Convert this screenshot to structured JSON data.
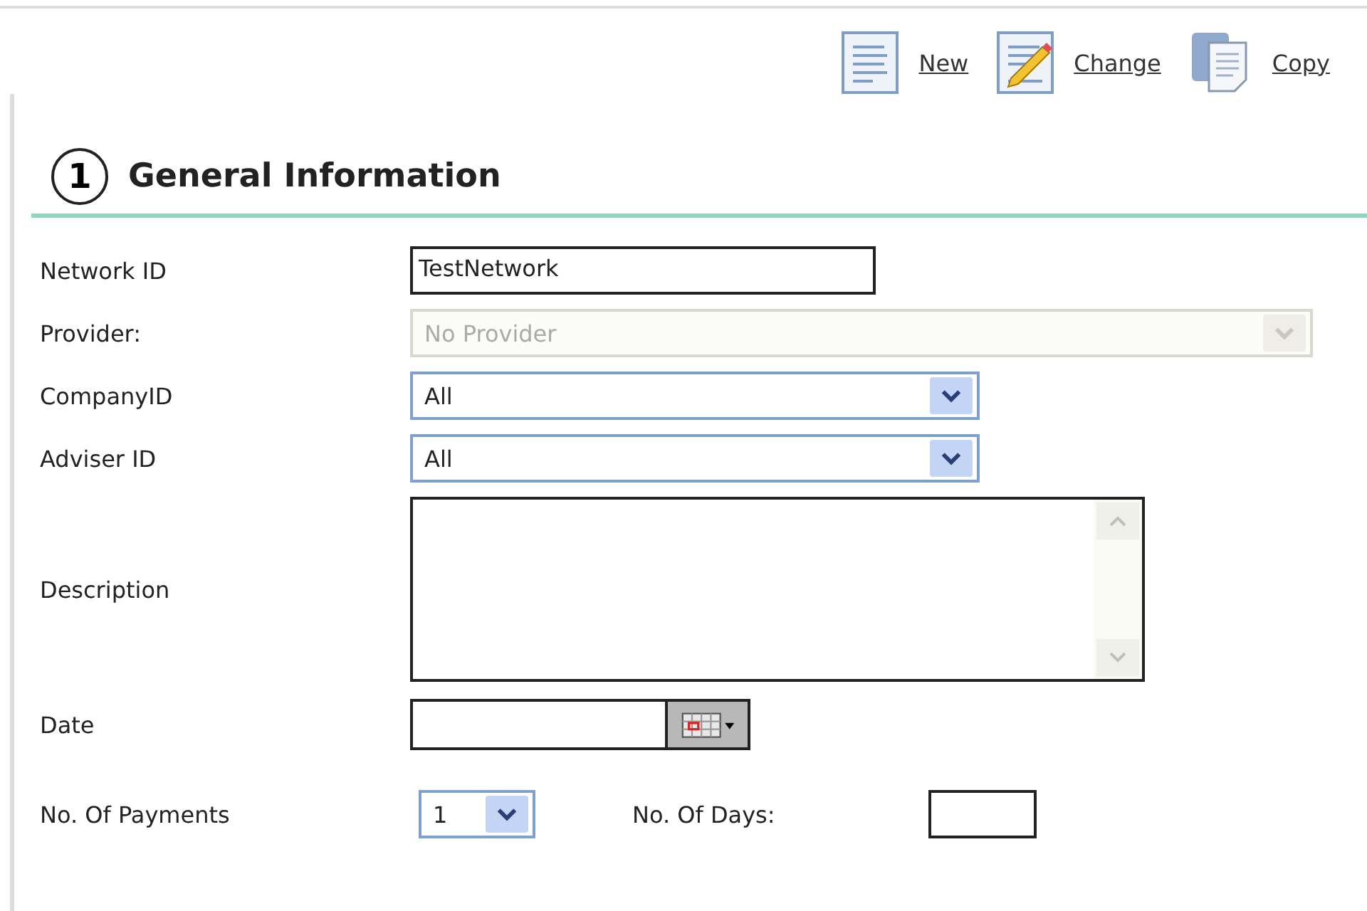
{
  "toolbar": [
    {
      "kind": "new",
      "label": "New"
    },
    {
      "kind": "change",
      "label": "Change"
    },
    {
      "kind": "copy",
      "label": "Copy"
    }
  ],
  "section": {
    "number": "1",
    "title": "General Information"
  },
  "fields": [
    {
      "kind": "text",
      "label": "Network ID",
      "value": "TestNetwork"
    },
    {
      "kind": "wide-select",
      "label": "Provider:",
      "value": "No Provider",
      "disabled": true
    },
    {
      "kind": "select",
      "label": "CompanyID",
      "value": "All",
      "disabled": false
    },
    {
      "kind": "select",
      "label": "Adviser ID",
      "value": "All",
      "disabled": false
    },
    {
      "kind": "textarea",
      "label": "Description"
    },
    {
      "kind": "date",
      "label": "Date"
    }
  ],
  "payments": {
    "label": "No. Of Payments",
    "value": "1",
    "days_label": "No. Of Days:"
  }
}
